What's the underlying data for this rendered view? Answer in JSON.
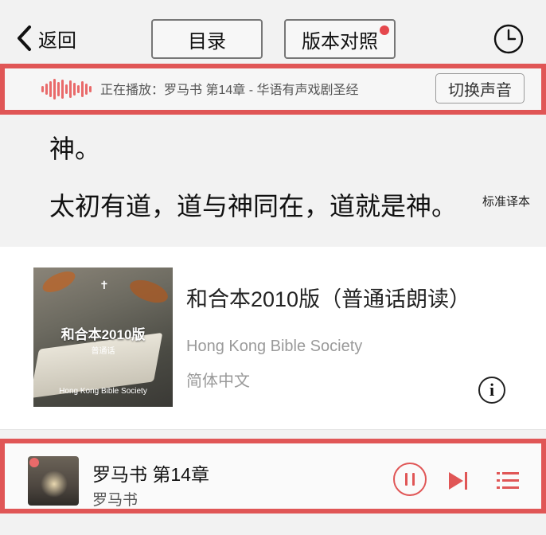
{
  "nav": {
    "back_label": "返回",
    "toc_label": "目录",
    "compare_label": "版本对照",
    "accent_color": "#e05656"
  },
  "now_playing": {
    "text": "正在播放：罗马书 第14章 - 华语有声戏剧圣经",
    "switch_label": "切换声音"
  },
  "reading": {
    "verse_tail": "神。",
    "verse_main": "太初有道，道与神同在，道就是神。",
    "version_tag": "标准译本"
  },
  "audio_version": {
    "title": "和合本2010版（普通话朗读）",
    "publisher": "Hong Kong Bible Society",
    "language": "简体中文",
    "cover": {
      "title": "和合本2010版",
      "subtitle": "普通话",
      "publisher": "Hong Kong Bible Society"
    }
  },
  "mini_player": {
    "title": "罗马书 第14章",
    "subtitle": "罗马书"
  },
  "icons": {
    "back": "chevron-left-icon",
    "history": "clock-icon",
    "wave": "audio-wave-icon",
    "info": "info-icon",
    "pause": "pause-icon",
    "next": "skip-next-icon",
    "playlist": "playlist-icon"
  }
}
